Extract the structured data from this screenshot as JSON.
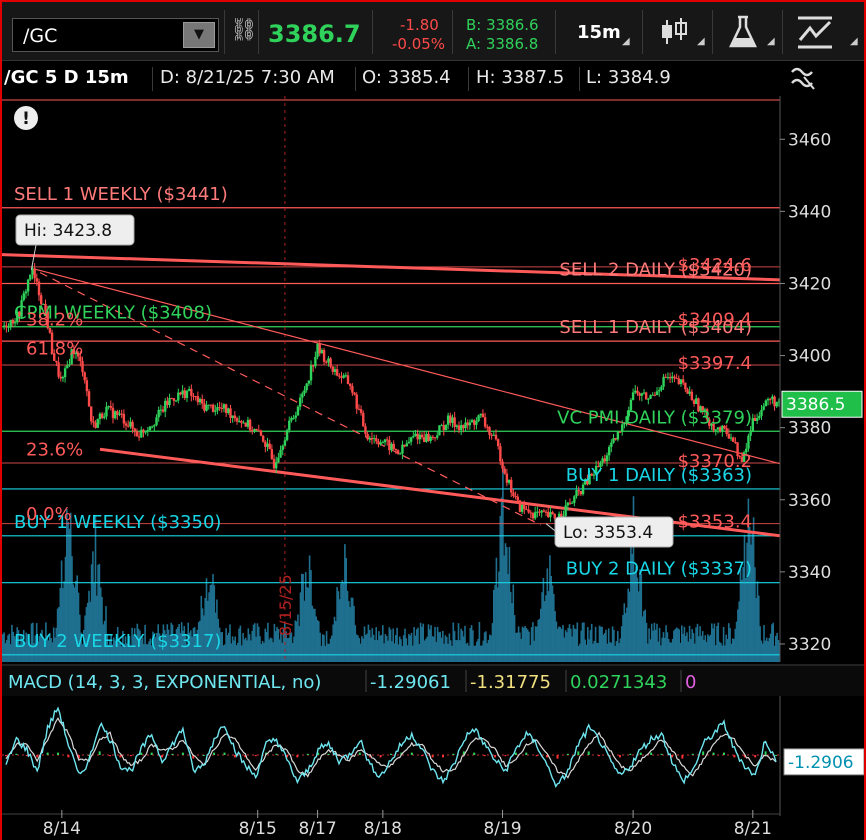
{
  "toolbar": {
    "symbol": "/GC",
    "last": "3386.7",
    "net_change": "-1.80",
    "net_change_pct": "-0.05%",
    "bid": "B: 3386.6",
    "ask": "A: 3386.8",
    "timeframe": "15m"
  },
  "infobar": {
    "title": "/GC 5 D 15m",
    "date": "D: 8/21/25 7:30 AM",
    "open": "O: 3385.4",
    "high": "H: 3387.5",
    "low": "L: 3384.9"
  },
  "colors": {
    "sell": "#ff5a5a",
    "sell_text": "#ff7a7a",
    "buy": "#18d6e6",
    "pmi": "#2fd25a",
    "up_candle": "#2fd25a",
    "down_candle": "#ff4a4a",
    "volume": "#1f6f8f",
    "macd_line": "#6ee6f0"
  },
  "chart_data": [
    {
      "type": "candlestick",
      "symbol": "/GC",
      "y_axis_ticks": [
        "3460",
        "3440",
        "3420",
        "3400",
        "3380",
        "3360",
        "3340",
        "3320"
      ],
      "ylim": [
        3315,
        3472
      ],
      "x_tick_labels": [
        "8/14",
        "8/15",
        "8/17",
        "8/18",
        "8/19",
        "8/20",
        "8/21"
      ],
      "x_tick_days": [
        1,
        2.8,
        3.35,
        3.95,
        5.05,
        6.25,
        7.35
      ],
      "x_range_days": [
        0.45,
        7.6
      ],
      "price_marker": "3386.5",
      "high_callout": "Hi: 3423.8",
      "high_value": 3423.8,
      "low_callout": "Lo: 3353.4",
      "low_value": 3353.4,
      "date_marker": "8/15/25",
      "date_marker_day": 3.05,
      "horizontal_levels": [
        {
          "label": "SELL 1 WEEKLY ($3441)",
          "value": 3441,
          "kind": "sell",
          "label_side": "left"
        },
        {
          "label": "SELL 2 DAILY ($3420)",
          "value": 3420,
          "kind": "sell",
          "label_side": "right"
        },
        {
          "label": "CPMI WEEKLY ($3408)",
          "value": 3408,
          "kind": "pmi",
          "label_side": "left"
        },
        {
          "label": "SELL 1 DAILY ($3404)",
          "value": 3404,
          "kind": "sell",
          "label_side": "right"
        },
        {
          "label": "VC PMI DAILY ($3379)",
          "value": 3379,
          "kind": "pmi",
          "label_side": "right"
        },
        {
          "label": "BUY 1 DAILY ($3363)",
          "value": 3363,
          "kind": "buy",
          "label_side": "right"
        },
        {
          "label": "BUY 1 WEEKLY ($3350)",
          "value": 3350,
          "kind": "buy",
          "label_side": "left"
        },
        {
          "label": "BUY 2 DAILY ($3337)",
          "value": 3337,
          "kind": "buy",
          "label_side": "right"
        },
        {
          "label": "BUY 2 WEEKLY ($3317)",
          "value": 3317,
          "kind": "buy",
          "label_side": "left"
        }
      ],
      "fib_levels": [
        {
          "label": "$3424.6",
          "value": 3424.6
        },
        {
          "label": "$3409.4",
          "value": 3409.4
        },
        {
          "label": "$3397.4",
          "value": 3397.4
        },
        {
          "label": "$3370.2",
          "value": 3370.2
        },
        {
          "label": "$3353.4",
          "value": 3353.4
        }
      ],
      "fib_pct_labels": [
        {
          "label": "38.2%",
          "value": 3410
        },
        {
          "label": "61.8%",
          "value": 3402
        },
        {
          "label": "23.6%",
          "value": 3374
        },
        {
          "label": "0.0%",
          "value": 3356
        }
      ],
      "price_path": [
        [
          0.45,
          3408
        ],
        [
          0.6,
          3411
        ],
        [
          0.72,
          3424
        ],
        [
          0.85,
          3412
        ],
        [
          0.92,
          3400
        ],
        [
          1.0,
          3392
        ],
        [
          1.1,
          3402
        ],
        [
          1.2,
          3396
        ],
        [
          1.28,
          3380
        ],
        [
          1.4,
          3385
        ],
        [
          1.55,
          3383
        ],
        [
          1.7,
          3378
        ],
        [
          1.85,
          3382
        ],
        [
          2.0,
          3388
        ],
        [
          2.15,
          3390
        ],
        [
          2.3,
          3386
        ],
        [
          2.5,
          3385
        ],
        [
          2.7,
          3381
        ],
        [
          2.85,
          3377
        ],
        [
          2.95,
          3370
        ],
        [
          3.05,
          3378
        ],
        [
          3.2,
          3388
        ],
        [
          3.35,
          3402
        ],
        [
          3.5,
          3396
        ],
        [
          3.65,
          3392
        ],
        [
          3.8,
          3378
        ],
        [
          3.95,
          3376
        ],
        [
          4.1,
          3373
        ],
        [
          4.25,
          3378
        ],
        [
          4.4,
          3377
        ],
        [
          4.55,
          3382
        ],
        [
          4.7,
          3380
        ],
        [
          4.85,
          3383
        ],
        [
          5.0,
          3375
        ],
        [
          5.1,
          3365
        ],
        [
          5.2,
          3358
        ],
        [
          5.35,
          3356
        ],
        [
          5.55,
          3355
        ],
        [
          5.7,
          3360
        ],
        [
          5.85,
          3366
        ],
        [
          6.0,
          3372
        ],
        [
          6.15,
          3380
        ],
        [
          6.25,
          3390
        ],
        [
          6.4,
          3388
        ],
        [
          6.55,
          3394
        ],
        [
          6.7,
          3392
        ],
        [
          6.85,
          3386
        ],
        [
          7.0,
          3380
        ],
        [
          7.15,
          3378
        ],
        [
          7.25,
          3370
        ],
        [
          7.35,
          3382
        ],
        [
          7.5,
          3388
        ],
        [
          7.6,
          3386.5
        ]
      ],
      "trendlines": [
        {
          "label": "upper channel",
          "from": [
            0.45,
            3428
          ],
          "to": [
            7.6,
            3421
          ]
        },
        {
          "label": "downtrend",
          "from": [
            0.75,
            3424
          ],
          "to": [
            7.6,
            3370
          ]
        },
        {
          "label": "lower channel",
          "from": [
            1.35,
            3374
          ],
          "to": [
            7.6,
            3350
          ]
        },
        {
          "label": "dashed fib",
          "from": [
            0.8,
            3423
          ],
          "to": [
            5.4,
            3353
          ]
        }
      ],
      "volume_ylim": [
        0,
        1
      ],
      "volume_bursts": [
        {
          "day": 1.05,
          "level": 0.85
        },
        {
          "day": 1.3,
          "level": 0.6
        },
        {
          "day": 2.35,
          "level": 0.45
        },
        {
          "day": 3.25,
          "level": 0.5
        },
        {
          "day": 3.6,
          "level": 0.55
        },
        {
          "day": 5.05,
          "level": 0.9
        },
        {
          "day": 5.45,
          "level": 0.55
        },
        {
          "day": 6.25,
          "level": 0.75
        },
        {
          "day": 7.3,
          "level": 0.95
        }
      ]
    },
    {
      "type": "line",
      "title": "MACD (14, 3, 3, EXPONENTIAL, no)",
      "values_text": [
        "-1.29061",
        "-1.31775",
        "0.0271343",
        "0"
      ],
      "value_colors": [
        "#6ee6f0",
        "#f0e080",
        "#2fd25a",
        "#e060e0"
      ],
      "price_marker": "-1.2906",
      "series": [
        {
          "name": "Value",
          "values": [
            -2,
            3,
            1,
            -3,
            5,
            9,
            2,
            -4,
            -1,
            6,
            3,
            -2,
            -3,
            1,
            4,
            -1,
            2,
            5,
            -3,
            -2,
            3,
            6,
            1,
            -2,
            -4,
            2,
            3,
            -1,
            -5,
            -3,
            1,
            2,
            -1,
            0,
            3,
            -2,
            -4,
            -1,
            2,
            4,
            1,
            -3,
            -5,
            -2,
            3,
            5,
            2,
            -1,
            -3,
            1,
            4,
            2,
            -2,
            -6,
            -3,
            2,
            5,
            3,
            -1,
            -4,
            -2,
            1,
            3,
            4,
            -1,
            -5,
            -3,
            2,
            4,
            6,
            1,
            -2,
            -4,
            3,
            -1.29
          ]
        },
        {
          "name": "Avg",
          "values": [
            -1,
            2,
            2,
            -1,
            3,
            7,
            4,
            -1,
            -1,
            3,
            4,
            0,
            -2,
            -1,
            2,
            1,
            1,
            3,
            0,
            -2,
            1,
            4,
            3,
            0,
            -3,
            0,
            2,
            1,
            -3,
            -4,
            -1,
            1,
            0,
            -1,
            1,
            0,
            -2,
            -2,
            0,
            2,
            2,
            -1,
            -3,
            -3,
            0,
            3,
            3,
            1,
            -2,
            -1,
            2,
            3,
            0,
            -3,
            -4,
            -1,
            2,
            4,
            1,
            -2,
            -3,
            -1,
            1,
            3,
            1,
            -2,
            -4,
            -1,
            2,
            4,
            3,
            0,
            -2,
            0,
            -1.32
          ]
        }
      ]
    }
  ]
}
